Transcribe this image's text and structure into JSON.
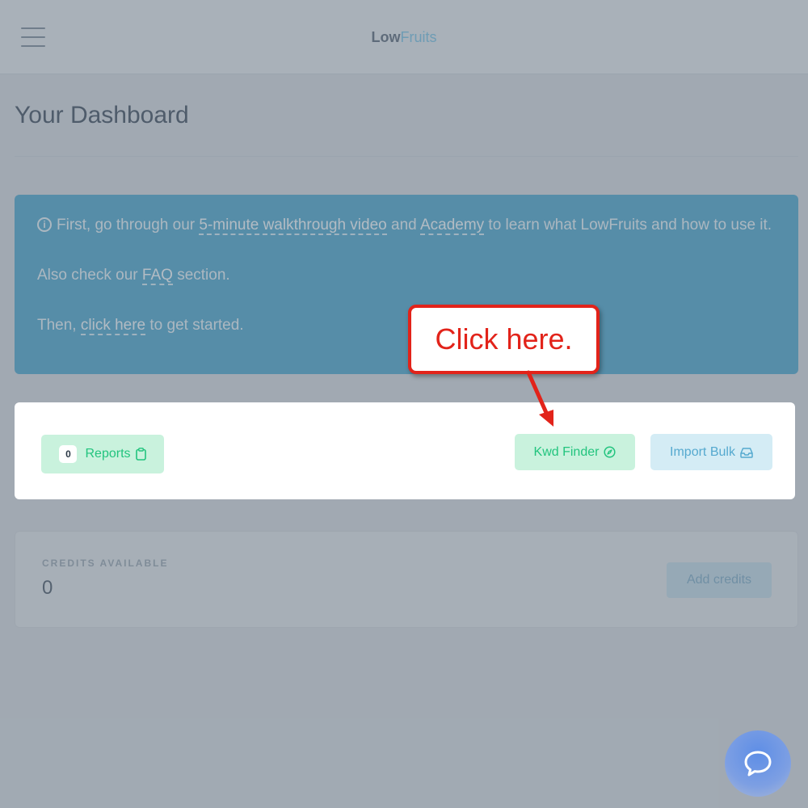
{
  "header": {
    "brand_part1": "Low",
    "brand_part2": "Fruits",
    "menu_icon": "hamburger-icon"
  },
  "page": {
    "title": "Your Dashboard"
  },
  "banner": {
    "info_icon": "info-icon",
    "line1_before": "First, go through our ",
    "line1_link1": "5-minute walkthrough video",
    "line1_mid": " and ",
    "line1_link2": "Academy",
    "line1_after": " to learn what LowFruits and how to use it.",
    "line2_before": "Also check our ",
    "line2_link": "FAQ",
    "line2_after": " section.",
    "line3_before": "Then, ",
    "line3_link": "click here",
    "line3_after": " to get started."
  },
  "actions": {
    "reports_count": "0",
    "reports_label": "Reports",
    "reports_icon": "clipboard-icon",
    "kwd_finder_label": "Kwd Finder",
    "kwd_finder_icon": "compass-icon",
    "import_bulk_label": "Import Bulk",
    "import_bulk_icon": "inbox-icon"
  },
  "credits": {
    "label": "CREDITS AVAILABLE",
    "value": "0",
    "add_label": "Add credits"
  },
  "callout": {
    "text": "Click here."
  },
  "chat": {
    "icon": "chat-bubble-icon"
  },
  "colors": {
    "accent_green": "#22c47e",
    "accent_blue": "#55a9cf",
    "banner_blue": "#5fb0d2",
    "callout_red": "#e2231a"
  }
}
